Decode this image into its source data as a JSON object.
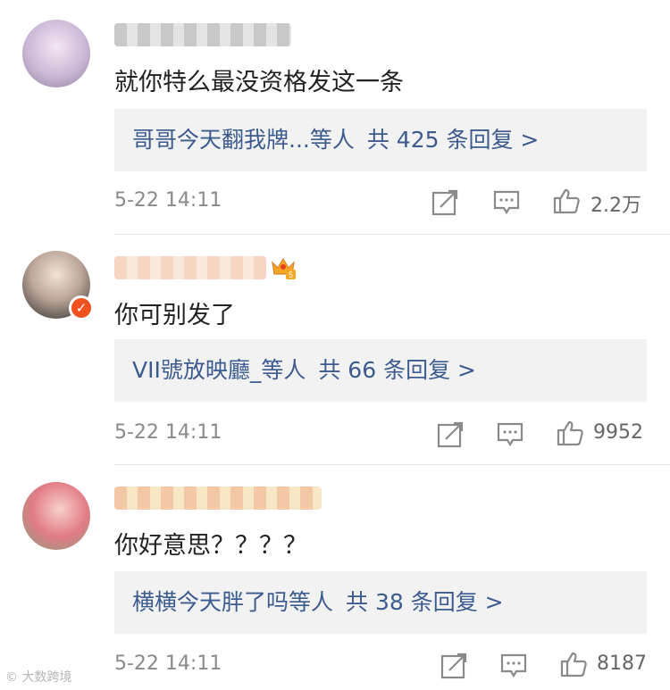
{
  "comments": [
    {
      "text": "就你特么最没资格发这一条",
      "reply_names": "哥哥今天翻我牌...等人",
      "reply_count": "共 425 条回复 >",
      "time": "5-22 14:11",
      "likes": "2.2万"
    },
    {
      "text": "你可别发了",
      "reply_names": "VII號放映廳_等人",
      "reply_count": "共 66 条回复 >",
      "time": "5-22 14:11",
      "likes": "9952"
    },
    {
      "text": "你好意思？？？？",
      "reply_names": "横横今天胖了吗等人",
      "reply_count": "共 38 条回复 >",
      "time": "5-22 14:11",
      "likes": "8187"
    }
  ],
  "watermark": "大数跨境",
  "icons": {
    "share": "share-icon",
    "comment": "comment-icon",
    "like": "like-icon",
    "verified": "verified-badge-icon",
    "crown": "crown-level-icon"
  },
  "colors": {
    "link": "#3c5b8f",
    "reply_bg": "#f2f2f2",
    "meta": "#8a8a8a",
    "verified": "#f0521f"
  }
}
